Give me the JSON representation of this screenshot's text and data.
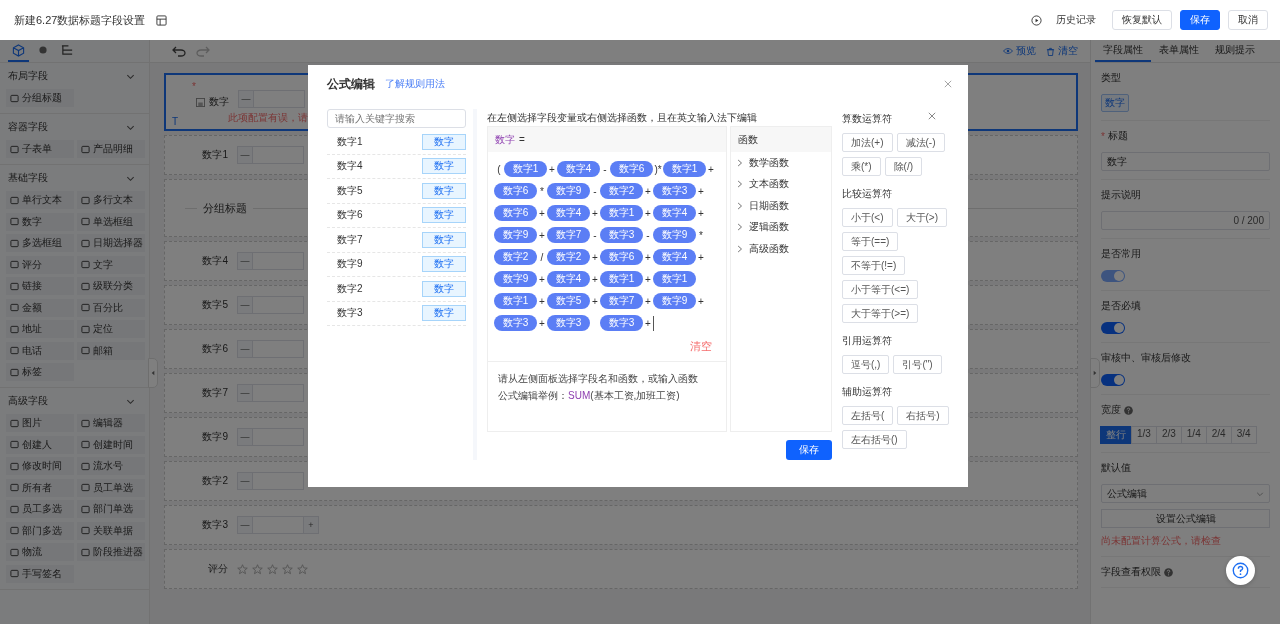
{
  "header": {
    "title": "新建6.27数据标题字段设置",
    "history": "历史记录",
    "buttons": [
      {
        "label": "恢复默认",
        "kind": "default"
      },
      {
        "label": "保存",
        "kind": "primary"
      },
      {
        "label": "取消",
        "kind": "default"
      }
    ]
  },
  "left_panel": {
    "tabs": [
      {
        "kind": "cube",
        "selected": true
      },
      {
        "kind": "info",
        "selected": false
      },
      {
        "kind": "tree",
        "selected": false
      }
    ],
    "groups": [
      {
        "title": "布局字段",
        "expanded": true,
        "items": [
          "分组标题"
        ]
      },
      {
        "title": "容器字段",
        "expanded": true,
        "items": [
          "子表单",
          "产品明细"
        ]
      },
      {
        "title": "基础字段",
        "expanded": true,
        "items": [
          "单行文本",
          "多行文本",
          "数字",
          "单选框组",
          "多选框组",
          "日期选择器",
          "评分",
          "文字",
          "链接",
          "级联分类",
          "金额",
          "百分比",
          "地址",
          "定位",
          "电话",
          "邮箱",
          "标签"
        ]
      },
      {
        "title": "高级字段",
        "expanded": true,
        "items": [
          "图片",
          "编辑器",
          "创建人",
          "创建时间",
          "修改时间",
          "流水号",
          "所有者",
          "员工单选",
          "员工多选",
          "部门单选",
          "部门多选",
          "关联单据",
          "物流",
          "阶段推进器",
          "手写签名"
        ]
      }
    ]
  },
  "canvas": {
    "preview": "预览",
    "clear": "清空",
    "rows": [
      {
        "kind": "number",
        "label": "数字",
        "required": true,
        "selected": true,
        "decrement": "—",
        "error": "此项配置有误，请",
        "marker": "T"
      },
      {
        "kind": "number",
        "label": "数字1",
        "required": false,
        "selected": false,
        "decrement": "—"
      },
      {
        "kind": "group",
        "label": "分组标题",
        "required": false,
        "selected": false
      },
      {
        "kind": "number",
        "label": "数字4",
        "required": false,
        "selected": false,
        "decrement": "—"
      },
      {
        "kind": "number",
        "label": "数字5",
        "required": false,
        "selected": false,
        "decrement": "—"
      },
      {
        "kind": "number",
        "label": "数字6",
        "required": false,
        "selected": false,
        "decrement": "—"
      },
      {
        "kind": "number",
        "label": "数字7",
        "required": false,
        "selected": false,
        "decrement": "—"
      },
      {
        "kind": "number",
        "label": "数字9",
        "required": false,
        "selected": false,
        "decrement": "—"
      },
      {
        "kind": "number",
        "label": "数字2",
        "required": false,
        "selected": false,
        "decrement": "—"
      },
      {
        "kind": "number",
        "label": "数字3",
        "required": false,
        "selected": false,
        "decrement": "—",
        "increment": "+"
      },
      {
        "kind": "rating",
        "label": "评分",
        "required": false,
        "selected": false,
        "stars": 0
      }
    ]
  },
  "properties": {
    "tabs": [
      {
        "label": "字段属性",
        "selected": true
      },
      {
        "label": "表单属性",
        "selected": false
      },
      {
        "label": "规则提示",
        "selected": false
      }
    ],
    "sections": [
      {
        "kind": "tag",
        "label": "类型",
        "required": false,
        "help": false,
        "value": "数字"
      },
      {
        "kind": "input",
        "label": "标题",
        "required": true,
        "help": false,
        "value": "数字"
      },
      {
        "kind": "textarea",
        "label": "提示说明",
        "required": false,
        "help": false,
        "counter": "0 / 200"
      },
      {
        "kind": "toggle",
        "label": "是否常用",
        "required": false,
        "help": false,
        "on": true,
        "disabled": true
      },
      {
        "kind": "toggle",
        "label": "是否必填",
        "required": false,
        "help": false,
        "on": true,
        "disabled": false
      },
      {
        "kind": "toggle",
        "label": "审核中、审核后修改",
        "required": false,
        "help": false,
        "on": true,
        "disabled": false
      },
      {
        "kind": "segmented",
        "label": "宽度",
        "required": false,
        "help": true,
        "options": [
          {
            "label": "整行",
            "selected": true
          },
          {
            "label": "1/3",
            "selected": false
          },
          {
            "label": "2/3",
            "selected": false
          },
          {
            "label": "1/4",
            "selected": false
          },
          {
            "label": "2/4",
            "selected": false
          },
          {
            "label": "3/4",
            "selected": false
          }
        ]
      },
      {
        "kind": "default",
        "label": "默认值",
        "required": false,
        "help": false,
        "select": "公式编辑",
        "button": "设置公式编辑",
        "error": "尚未配置计算公式，请检查"
      },
      {
        "kind": "heading",
        "label": "字段查看权限",
        "required": false,
        "help": true
      }
    ]
  },
  "dialog": {
    "title": "公式编辑",
    "help_link": "了解规则用法",
    "search_placeholder": "请输入关键字搜索",
    "fields": [
      {
        "name": "数字1",
        "type": "数字"
      },
      {
        "name": "数字4",
        "type": "数字"
      },
      {
        "name": "数字5",
        "type": "数字"
      },
      {
        "name": "数字6",
        "type": "数字"
      },
      {
        "name": "数字7",
        "type": "数字"
      },
      {
        "name": "数字9",
        "type": "数字"
      },
      {
        "name": "数字2",
        "type": "数字"
      },
      {
        "name": "数字3",
        "type": "数字"
      }
    ],
    "instruction": "在左侧选择字段变量或右侧选择函数，且在英文输入法下编辑",
    "target": "数字",
    "equals": "=",
    "lines": [
      [
        {
          "kind": "op",
          "text": "("
        },
        {
          "kind": "field",
          "text": "数字1"
        },
        {
          "kind": "op",
          "text": "+"
        },
        {
          "kind": "field",
          "text": "数字4"
        },
        {
          "kind": "op",
          "text": "-"
        },
        {
          "kind": "field",
          "text": "数字6"
        },
        {
          "kind": "op",
          "text": ")*"
        },
        {
          "kind": "field",
          "text": "数字1"
        },
        {
          "kind": "op",
          "text": "+"
        }
      ],
      [
        {
          "kind": "field",
          "text": "数字6"
        },
        {
          "kind": "op",
          "text": "*"
        },
        {
          "kind": "field",
          "text": "数字9"
        },
        {
          "kind": "op",
          "text": "-"
        },
        {
          "kind": "field",
          "text": "数字2"
        },
        {
          "kind": "op",
          "text": "+"
        },
        {
          "kind": "field",
          "text": "数字3"
        },
        {
          "kind": "op",
          "text": "+"
        }
      ],
      [
        {
          "kind": "field",
          "text": "数字6"
        },
        {
          "kind": "op",
          "text": "+"
        },
        {
          "kind": "field",
          "text": "数字4"
        },
        {
          "kind": "op",
          "text": "+"
        },
        {
          "kind": "field",
          "text": "数字1"
        },
        {
          "kind": "op",
          "text": "+"
        },
        {
          "kind": "field",
          "text": "数字4"
        },
        {
          "kind": "op",
          "text": "+"
        }
      ],
      [
        {
          "kind": "field",
          "text": "数字9"
        },
        {
          "kind": "op",
          "text": "+"
        },
        {
          "kind": "field",
          "text": "数字7"
        },
        {
          "kind": "op",
          "text": "-"
        },
        {
          "kind": "field",
          "text": "数字3"
        },
        {
          "kind": "op",
          "text": "-"
        },
        {
          "kind": "field",
          "text": "数字9"
        },
        {
          "kind": "op",
          "text": "*"
        }
      ],
      [
        {
          "kind": "field",
          "text": "数字2"
        },
        {
          "kind": "op",
          "text": "/"
        },
        {
          "kind": "field",
          "text": "数字2"
        },
        {
          "kind": "op",
          "text": "+"
        },
        {
          "kind": "field",
          "text": "数字6"
        },
        {
          "kind": "op",
          "text": "+"
        },
        {
          "kind": "field",
          "text": "数字4"
        },
        {
          "kind": "op",
          "text": "+"
        }
      ],
      [
        {
          "kind": "field",
          "text": "数字9"
        },
        {
          "kind": "op",
          "text": "+"
        },
        {
          "kind": "field",
          "text": "数字4"
        },
        {
          "kind": "op",
          "text": "+"
        },
        {
          "kind": "field",
          "text": "数字1"
        },
        {
          "kind": "op",
          "text": "+"
        },
        {
          "kind": "field",
          "text": "数字1"
        }
      ],
      [
        {
          "kind": "field",
          "text": "数字1"
        },
        {
          "kind": "op",
          "text": "+"
        },
        {
          "kind": "field",
          "text": "数字5"
        },
        {
          "kind": "op",
          "text": "+"
        },
        {
          "kind": "field",
          "text": "数字7"
        },
        {
          "kind": "op",
          "text": "+"
        },
        {
          "kind": "field",
          "text": "数字9"
        },
        {
          "kind": "op",
          "text": "+"
        }
      ],
      [
        {
          "kind": "field",
          "text": "数字3"
        },
        {
          "kind": "op",
          "text": "+"
        },
        {
          "kind": "field",
          "text": "数字3"
        },
        {
          "kind": "space"
        },
        {
          "kind": "field",
          "text": "数字3"
        },
        {
          "kind": "op",
          "text": "+"
        }
      ]
    ],
    "clear": "清空",
    "hint": "请从左侧面板选择字段名和函数，或输入函数",
    "example_label": "公式编辑举例：",
    "example_fn": "SUM",
    "example_args": "(基本工资,加班工资)",
    "functions_title": "函数",
    "functions": [
      "数学函数",
      "文本函数",
      "日期函数",
      "逻辑函数",
      "高级函数"
    ],
    "operator_groups": [
      {
        "title": "算数运算符",
        "items": [
          "加法(+)",
          "减法(-)",
          "乘(*)",
          "除(/)"
        ]
      },
      {
        "title": "比较运算符",
        "items": [
          "小于(<)",
          "大于(>)",
          "等于(==)",
          "不等于(!=)",
          "小于等于(<=)",
          "大于等于(>=)"
        ]
      },
      {
        "title": "引用运算符",
        "items": [
          "逗号(,)",
          "引号(\")"
        ]
      },
      {
        "title": "辅助运算符",
        "items": [
          "左括号(",
          "右括号)",
          "左右括号()"
        ]
      }
    ],
    "save": "保存"
  }
}
